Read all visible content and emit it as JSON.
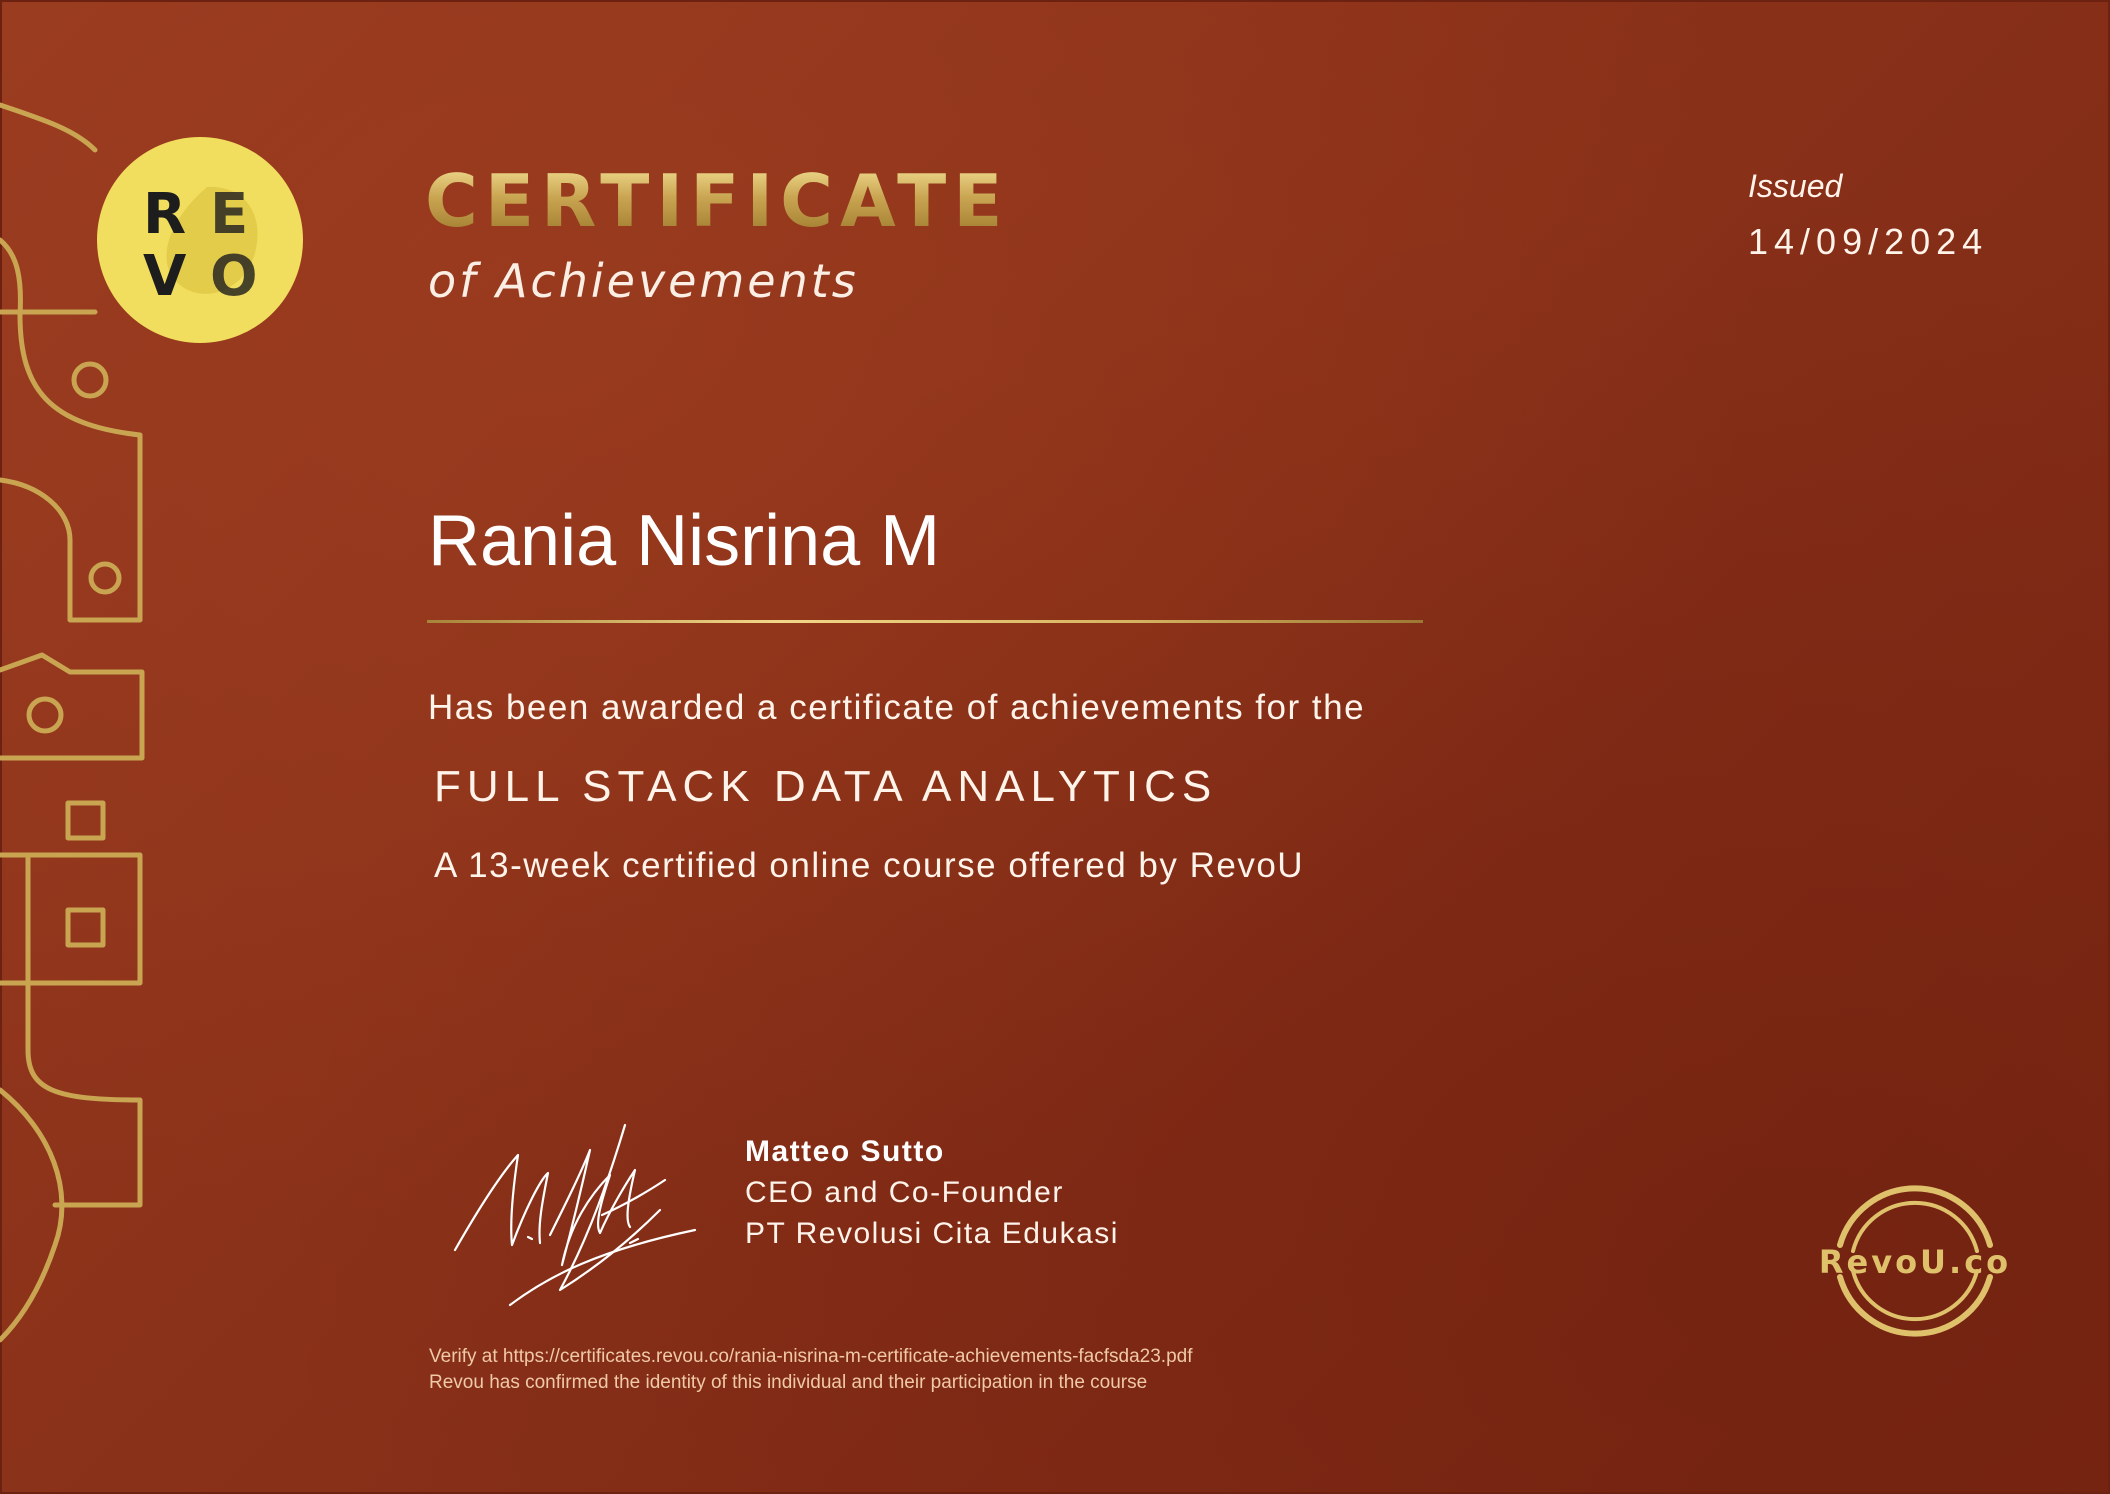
{
  "logo": {
    "wordmark_letters": [
      "R",
      "E",
      "V",
      "O"
    ]
  },
  "header": {
    "title": "CERTIFICATE",
    "subtitle": "of Achievements"
  },
  "issued": {
    "label": "Issued",
    "date": "14/09/2024"
  },
  "recipient": {
    "name": "Rania Nisrina M"
  },
  "body": {
    "awarded_text": "Has been awarded a certificate of achievements for the",
    "course_title": "FULL STACK DATA ANALYTICS",
    "course_description": "A 13-week certified online course offered by RevoU"
  },
  "signatory": {
    "name": "Matteo Sutto",
    "role": "CEO and Co-Founder",
    "company": "PT Revolusi Cita Edukasi"
  },
  "footer": {
    "verify_text": "Verify at https://certificates.revou.co/rania-nisrina-m-certificate-achievements-facfsda23.pdf",
    "confirmation_text": "Revou has confirmed the identity of this individual and their participation in the course"
  },
  "seal": {
    "text": "RevoU.co"
  },
  "colors": {
    "background": "#8a3119",
    "gold": "#c9a552",
    "logo_yellow": "#f2de5e",
    "text_light": "#fff3ea"
  }
}
